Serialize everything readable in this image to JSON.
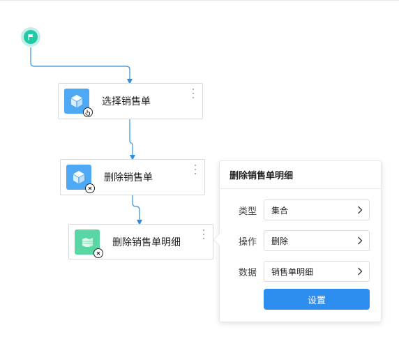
{
  "canvas": {
    "start_node": {
      "icon": "flag-icon"
    },
    "nodes": [
      {
        "label": "选择销售单",
        "icon": "cube-icon",
        "badge": "hand-pointer-icon"
      },
      {
        "label": "删除销售单",
        "icon": "cube-icon",
        "badge": "delete-x-icon"
      },
      {
        "label": "删除销售单明细",
        "icon": "table-icon",
        "badge": "delete-x-icon"
      }
    ]
  },
  "panel": {
    "title": "删除销售单明细",
    "fields": [
      {
        "label": "类型",
        "value": "集合"
      },
      {
        "label": "操作",
        "value": "删除"
      },
      {
        "label": "数据",
        "value": "销售单明细"
      }
    ],
    "button": "设置"
  },
  "colors": {
    "connector": "#2d8fdd",
    "start_node": "#22c9a6",
    "node_icon_blue": "#4ea8f3",
    "node_icon_green": "#5ad6a4",
    "primary_button": "#2e8ef0"
  }
}
